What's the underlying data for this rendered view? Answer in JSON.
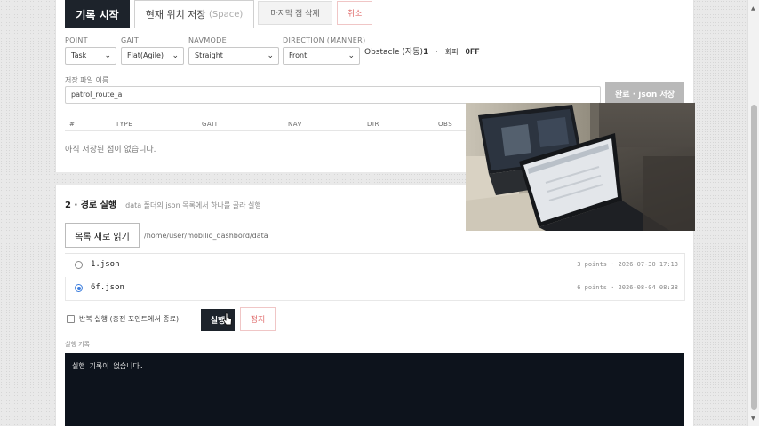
{
  "recorder": {
    "start_label": "기록 시작",
    "save_pos_label": "현재 위치 저장",
    "save_pos_hint": "(Space)",
    "delete_last_label": "마지막 점 삭제",
    "cancel_label": "취소",
    "fields": {
      "point": {
        "label": "POINT",
        "value": "Task"
      },
      "gait": {
        "label": "GAIT",
        "value": "Flat(Agile)"
      },
      "navmode": {
        "label": "NAVMODE",
        "value": "Straight"
      },
      "direction": {
        "label": "DIRECTION (MANNER)",
        "value": "Front"
      }
    },
    "obstacle": {
      "label": "Obstacle (자동)",
      "count": "1",
      "sep": "·",
      "avoid_label": "회피",
      "state": "OFF"
    },
    "filename_label": "저장 파일 이름",
    "filename_value": "patrol_route_a",
    "save_json_label": "완료 · json 저장",
    "table_headers": [
      "#",
      "TYPE",
      "GAIT",
      "NAV",
      "DIR",
      "OBS"
    ],
    "empty_text": "아직 저장된 점이 없습니다."
  },
  "runner": {
    "title": "2 · 경로 실행",
    "subtitle": "data 폴더의 json 목록에서 하나를 골라 실행",
    "reload_label": "목록 새로 읽기",
    "path": "/home/user/mobilio_dashbord/data",
    "files": [
      {
        "name": "1.json",
        "meta": "3 points · 2026-07-30 17:13",
        "selected": false
      },
      {
        "name": "6f.json",
        "meta": "6 points · 2026-08-04 08:38",
        "selected": true
      }
    ],
    "repeat_label": "반복 실행 (충전 포인트에서 종료)",
    "run_label": "실행",
    "stop_label": "정지",
    "log_label": "실행 기록",
    "log_text": "실행 기록이 없습니다."
  },
  "colors": {
    "dark": "#1d232b",
    "accent": "#3b7ddd",
    "danger": "#e06c6c"
  }
}
